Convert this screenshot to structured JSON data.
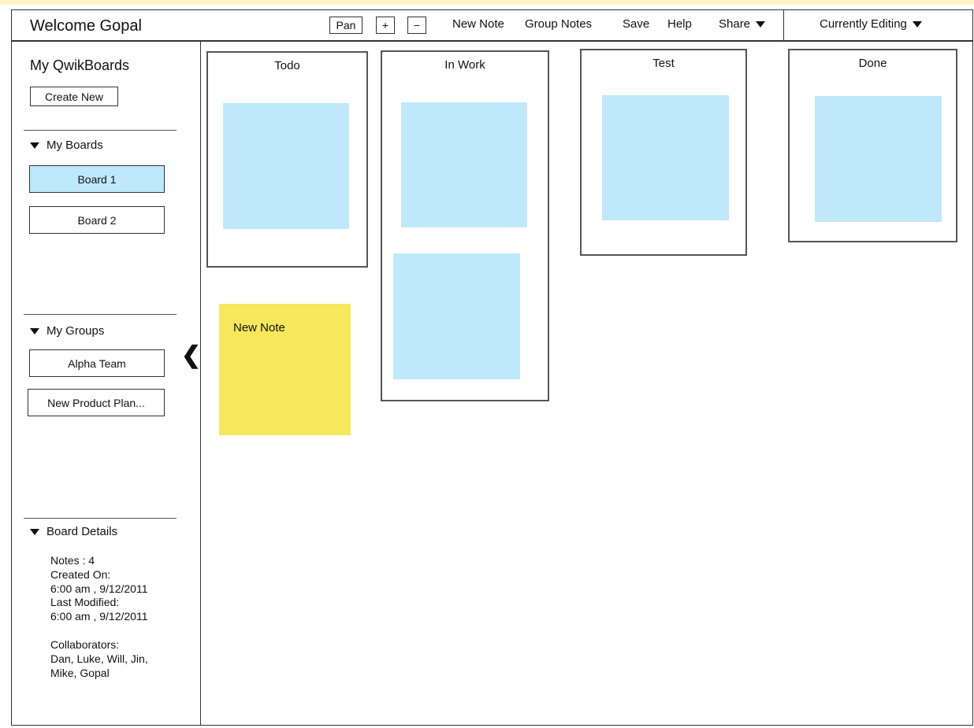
{
  "header": {
    "welcome": "Welcome Gopal",
    "toolbar": {
      "pan": "Pan",
      "zoom_in": "+",
      "zoom_out": "−",
      "new_note": "New Note",
      "group_notes": "Group Notes",
      "save": "Save",
      "help": "Help",
      "share": "Share",
      "editing": "Currently Editing"
    }
  },
  "sidebar": {
    "title": "My QwikBoards",
    "create_new": "Create New",
    "boards_label": "My Boards",
    "boards": [
      "Board 1",
      "Board 2"
    ],
    "groups_label": "My Groups",
    "groups": [
      "Alpha Team",
      "New Product Plan..."
    ],
    "details_label": "Board Details",
    "details": {
      "notes": "Notes : 4",
      "created_label": "Created On:",
      "created": "6:00 am , 9/12/2011",
      "modified_label": "Last Modified:",
      "modified": "6:00 am , 9/12/2011",
      "collab_label": "Collaborators:",
      "collab_line1": "Dan, Luke, Will, Jin,",
      "collab_line2": "Mike, Gopal"
    }
  },
  "board": {
    "columns": [
      "Todo",
      "In Work",
      "Test",
      "Done"
    ],
    "new_note": "New Note"
  },
  "colors": {
    "note_blue": "#bfe9fa",
    "note_yellow": "#f6e75d"
  }
}
